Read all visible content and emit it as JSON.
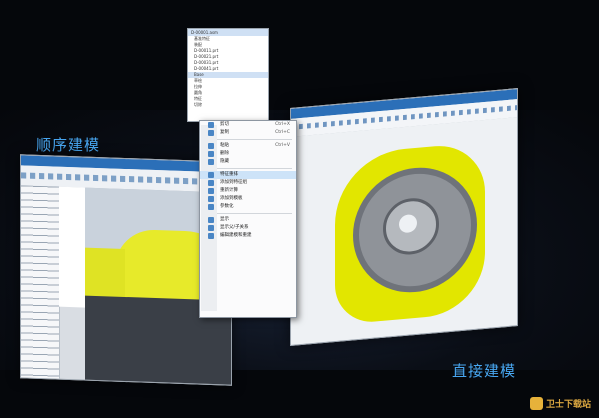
{
  "labels": {
    "left": "顺序建模",
    "right": "直接建模"
  },
  "tree": {
    "items": [
      "D-00001.asm",
      "基准特征",
      "装配",
      "D-00011.prt",
      "D-00021.prt",
      "D-00031.prt",
      "D-00041.prt",
      "Base",
      "草绘",
      "拉伸",
      "圆角",
      "特征",
      "切除"
    ]
  },
  "context_menu": {
    "items": [
      {
        "label": "剪切",
        "shortcut": "Ctrl+X"
      },
      {
        "label": "复制",
        "shortcut": "Ctrl+C"
      },
      {
        "label": "粘贴",
        "shortcut": "Ctrl+V"
      },
      {
        "label": "删除",
        "shortcut": ""
      },
      {
        "label": "隐藏",
        "shortcut": ""
      },
      {
        "label": "特征重排",
        "shortcut": ""
      },
      {
        "label": "添加到特征组",
        "shortcut": ""
      },
      {
        "label": "重新计算",
        "shortcut": ""
      },
      {
        "label": "添加到模板",
        "shortcut": ""
      },
      {
        "label": "参数化",
        "shortcut": ""
      },
      {
        "label": "显示",
        "shortcut": ""
      },
      {
        "label": "显示父/子关系",
        "shortcut": ""
      },
      {
        "label": "编辑建模和重建",
        "shortcut": ""
      }
    ],
    "highlighted_index": 5
  },
  "watermark": {
    "text": "卫士下载站"
  },
  "colors": {
    "accent_label": "#48a6f0",
    "part_yellow": "#e2e600",
    "title_bar": "#2b6fb8"
  }
}
